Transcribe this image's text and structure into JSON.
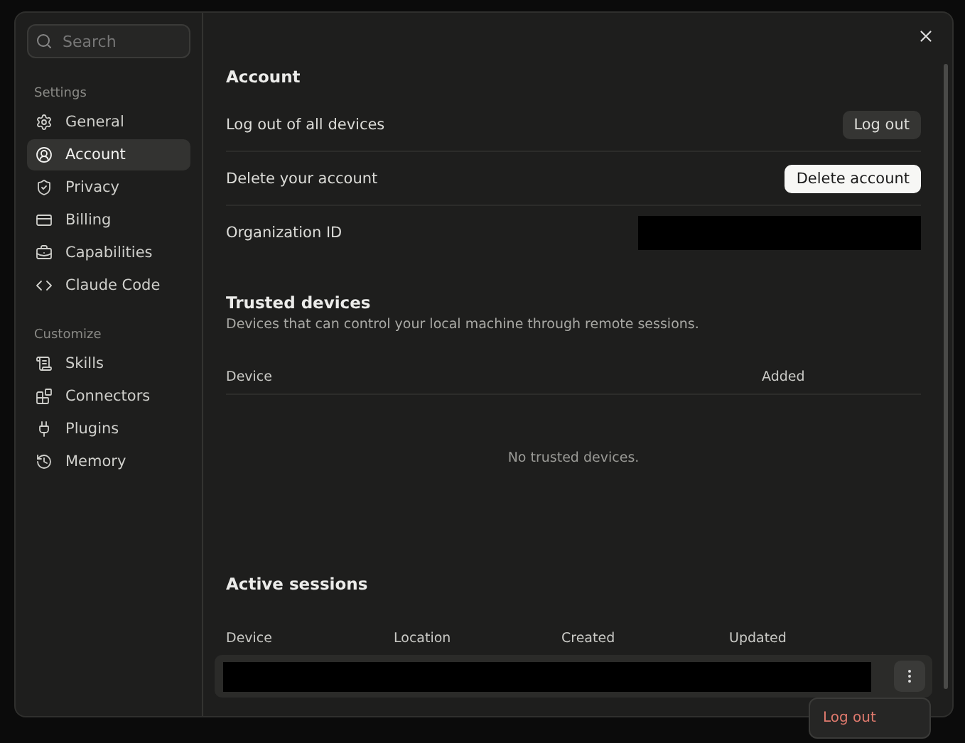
{
  "sidebar": {
    "search": {
      "placeholder": "Search"
    },
    "groups": [
      {
        "label": "Settings",
        "items": [
          {
            "label": "General",
            "selected": false
          },
          {
            "label": "Account",
            "selected": true
          },
          {
            "label": "Privacy",
            "selected": false
          },
          {
            "label": "Billing",
            "selected": false
          },
          {
            "label": "Capabilities",
            "selected": false
          },
          {
            "label": "Claude Code",
            "selected": false
          }
        ]
      },
      {
        "label": "Customize",
        "items": [
          {
            "label": "Skills",
            "selected": false
          },
          {
            "label": "Connectors",
            "selected": false
          },
          {
            "label": "Plugins",
            "selected": false
          },
          {
            "label": "Memory",
            "selected": false
          }
        ]
      }
    ]
  },
  "account": {
    "title": "Account",
    "rows": [
      {
        "label": "Log out of all devices",
        "kind": "button",
        "action": "Log out",
        "primary": false
      },
      {
        "label": "Delete your account",
        "kind": "button",
        "action": "Delete account",
        "primary": true
      },
      {
        "label": "Organization ID",
        "kind": "redacted"
      }
    ]
  },
  "trusted_devices": {
    "title": "Trusted devices",
    "description": "Devices that can control your local machine through remote sessions.",
    "columns": [
      "Device",
      "Added"
    ],
    "empty": "No trusted devices."
  },
  "active_sessions": {
    "title": "Active sessions",
    "columns": [
      "Device",
      "Location",
      "Created",
      "Updated"
    ],
    "menu": {
      "items": [
        "Log out"
      ]
    }
  }
}
